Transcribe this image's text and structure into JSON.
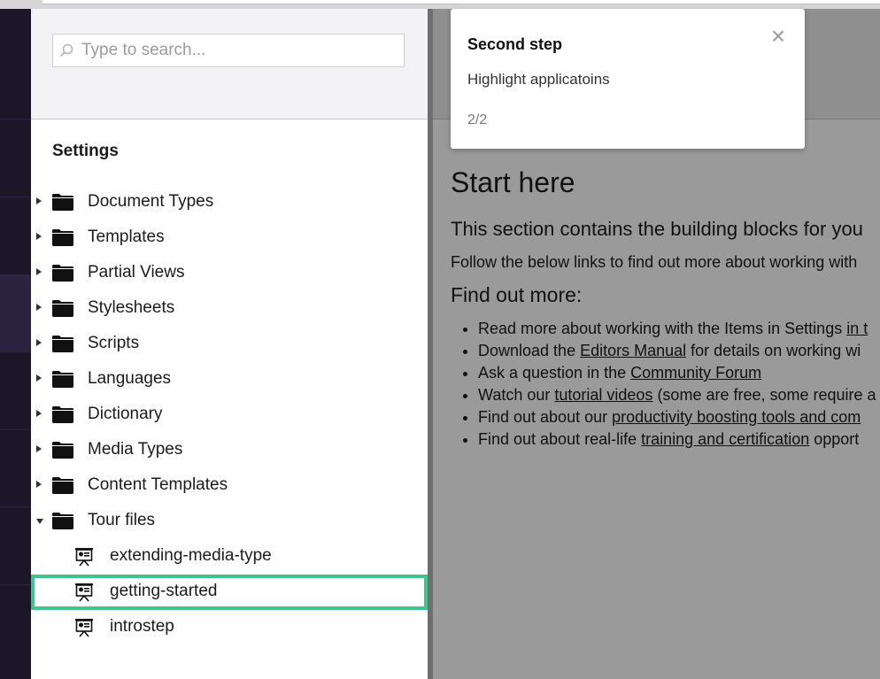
{
  "search": {
    "placeholder": "Type to search..."
  },
  "tree": {
    "section_title": "Settings",
    "items": [
      {
        "label": "Document Types"
      },
      {
        "label": "Templates"
      },
      {
        "label": "Partial Views"
      },
      {
        "label": "Stylesheets"
      },
      {
        "label": "Scripts"
      },
      {
        "label": "Languages"
      },
      {
        "label": "Dictionary"
      },
      {
        "label": "Media Types"
      },
      {
        "label": "Content Templates"
      },
      {
        "label": "Tour files"
      }
    ],
    "tour_files": [
      {
        "label": "extending-media-type"
      },
      {
        "label": "getting-started"
      },
      {
        "label": "introstep"
      }
    ],
    "highlight_color": "#3fc58c"
  },
  "tour": {
    "title": "Second step",
    "body": "Highlight applicatoins",
    "progress": "2/2",
    "close_symbol": "×"
  },
  "content": {
    "heading": "Start here",
    "lead": "This section contains the building blocks for you",
    "intro": "Follow the below links to find out more about working with",
    "subheading": "Find out more:",
    "bullets": [
      {
        "before": "Read more about working with the Items in Settings ",
        "link": "in t",
        "after": ""
      },
      {
        "before": "Download the ",
        "link": "Editors Manual",
        "after": " for details on working wi"
      },
      {
        "before": "Ask a question in the ",
        "link": "Community Forum",
        "after": ""
      },
      {
        "before": "Watch our ",
        "link": "tutorial videos",
        "after": " (some are free, some require a"
      },
      {
        "before": "Find out about our ",
        "link": "productivity boosting tools and com",
        "after": ""
      },
      {
        "before": "Find out about real-life ",
        "link": "training and certification",
        "after": " opport"
      }
    ]
  }
}
